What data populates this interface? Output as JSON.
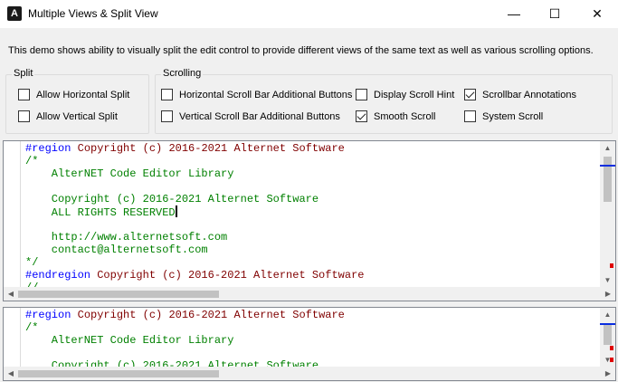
{
  "window": {
    "title": "Multiple Views & Split View",
    "minimize_glyph": "—",
    "maximize_glyph": "☐",
    "close_glyph": "✕"
  },
  "description": "This demo shows ability to visually split the edit control to provide different views of the same text as well as various scrolling options.",
  "split": {
    "legend": "Split",
    "allow_horizontal": {
      "label": "Allow Horizontal Split",
      "checked": false
    },
    "allow_vertical": {
      "label": "Allow Vertical Split",
      "checked": false
    }
  },
  "scrolling": {
    "legend": "Scrolling",
    "horizontal_buttons": {
      "label": "Horizontal Scroll Bar Additional Buttons",
      "checked": false
    },
    "vertical_buttons": {
      "label": "Vertical Scroll Bar Additional Buttons",
      "checked": false
    },
    "display_hint": {
      "label": "Display Scroll Hint",
      "checked": false
    },
    "smooth_scroll": {
      "label": "Smooth Scroll",
      "checked": true
    },
    "annotations": {
      "label": "Scrollbar Annotations",
      "checked": true
    },
    "system_scroll": {
      "label": "System Scroll",
      "checked": false
    }
  },
  "editor": {
    "top_lines": [
      {
        "kw": "#region",
        "txt": " Copyright (c) 2016-2021 Alternet Software"
      },
      {
        "cm": "/*"
      },
      {
        "cm": "    AlterNET Code Editor Library"
      },
      {
        "cm": ""
      },
      {
        "cm": "    Copyright (c) 2016-2021 Alternet Software"
      },
      {
        "cm": "    ALL RIGHTS RESERVED"
      },
      {
        "cm": ""
      },
      {
        "cm": "    http://www.alternetsoft.com"
      },
      {
        "cm": "    contact@alternetsoft.com"
      },
      {
        "cm": "*/"
      },
      {
        "kw": "#endregion",
        "txt": " Copyright (c) 2016-2021 Alternet Software"
      },
      {
        "cm": "//"
      }
    ],
    "bottom_lines": [
      {
        "kw": "#region",
        "txt": " Copyright (c) 2016-2021 Alternet Software"
      },
      {
        "cm": "/*"
      },
      {
        "cm": "    AlterNET Code Editor Library"
      },
      {
        "cm": ""
      },
      {
        "cm": "    Copyright (c) 2016-2021 Alternet Software"
      }
    ],
    "caret_line": 5
  },
  "colors": {
    "keyword": "#0000ff",
    "comment": "#008000",
    "region_text": "#800000",
    "annotation_blue": "#0a2ee0",
    "annotation_red": "#e00000"
  },
  "icons": {
    "app": "alternet-logo-icon",
    "scroll_up": "arrow-up-icon",
    "scroll_down": "arrow-down-icon",
    "scroll_left": "arrow-left-icon",
    "scroll_right": "arrow-right-icon"
  }
}
